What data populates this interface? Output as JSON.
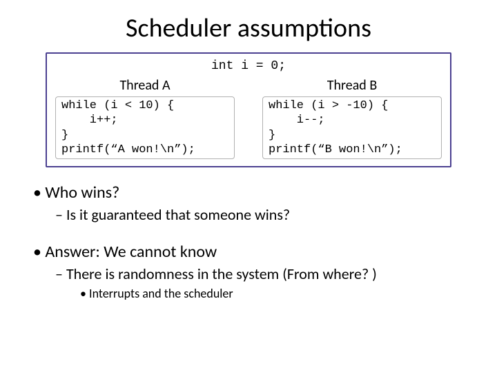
{
  "title": "Scheduler assumptions",
  "code": {
    "init": "int i = 0;",
    "threadA": {
      "label": "Thread A",
      "src": "while (i < 10) {\n    i++;\n}\nprintf(“A won!\\n”);"
    },
    "threadB": {
      "label": "Thread B",
      "src": "while (i > -10) {\n    i--;\n}\nprintf(“B won!\\n”);"
    }
  },
  "bullets": {
    "q1": "Who wins?",
    "q1a": "Is it guaranteed that someone wins?",
    "a1": "Answer: We cannot know",
    "a1a": "There is randomness in the system (From where? )",
    "a1a1": "Interrupts and the scheduler"
  }
}
